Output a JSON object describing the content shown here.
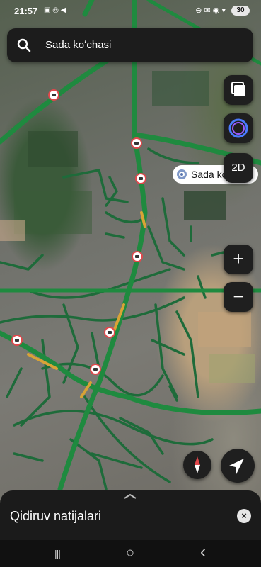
{
  "status_bar": {
    "time": "21:57",
    "left_icons": "▣ ◎ ◀",
    "right_icons": "⊖ ✉ ◉ ▾",
    "battery": "30"
  },
  "search": {
    "query": "Sada koʻchasi"
  },
  "map": {
    "pin_label": "Sada koʻchasi",
    "view_mode_label": "2D",
    "zoom_in_label": "+",
    "zoom_out_label": "−",
    "road_color": "#2e7d4e",
    "highway_color": "#27a34a",
    "slow_traffic_color": "#d8a336",
    "camera_color": "#e2474b"
  },
  "sheet": {
    "title": "Qidiruv natijalari",
    "close_label": "×"
  },
  "nav": {
    "recents": "|||",
    "home": "○",
    "back": "‹"
  },
  "icons": [
    "search-icon",
    "layers-icon",
    "alice-icon",
    "compass-icon",
    "locate-icon",
    "camera-icon",
    "pin-icon",
    "close-icon"
  ]
}
